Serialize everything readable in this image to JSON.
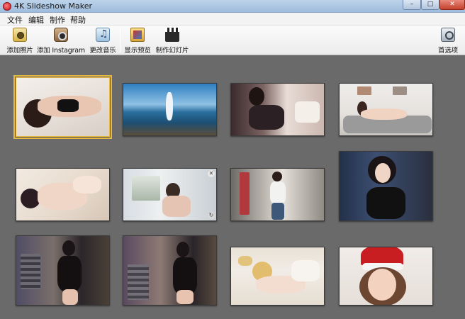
{
  "window": {
    "title": "4K Slideshow Maker",
    "controls": {
      "minimize": "–",
      "maximize": "□",
      "close": "✕"
    }
  },
  "menu": [
    "文件",
    "编辑",
    "制作",
    "帮助"
  ],
  "toolbar": {
    "add_photo": {
      "label": "添加照片",
      "icon": "add-photo-icon"
    },
    "add_instagram": {
      "label": "添加 Instagram",
      "icon": "instagram-camera-icon"
    },
    "change_music": {
      "label": "更改音乐",
      "icon": "music-icon"
    },
    "show_preview": {
      "label": "显示预览",
      "icon": "preview-icon"
    },
    "make_slideshow": {
      "label": "制作幻灯片",
      "icon": "clapperboard-icon"
    },
    "preferences": {
      "label": "首选项",
      "icon": "preferences-icon"
    }
  },
  "thumbnail_controls": {
    "remove": "✕",
    "rotate": "↻"
  },
  "thumbnails": [
    {
      "subject": "woman-lying-on-bed",
      "selected": true
    },
    {
      "subject": "beach-dancer-at-sea"
    },
    {
      "subject": "woman-on-white-sofa-dark-stockings"
    },
    {
      "subject": "woman-reclining-on-grey-sofa"
    },
    {
      "subject": "woman-lying-light-background"
    },
    {
      "subject": "woman-at-desk-in-office",
      "hovered": true
    },
    {
      "subject": "woman-in-white-tank-top-street"
    },
    {
      "subject": "woman-with-glasses-black-top"
    },
    {
      "subject": "woman-in-black-dress-by-window"
    },
    {
      "subject": "woman-in-black-with-glasses-posing"
    },
    {
      "subject": "blonde-woman-lying-in-bed"
    },
    {
      "subject": "girl-with-santa-hat"
    }
  ]
}
